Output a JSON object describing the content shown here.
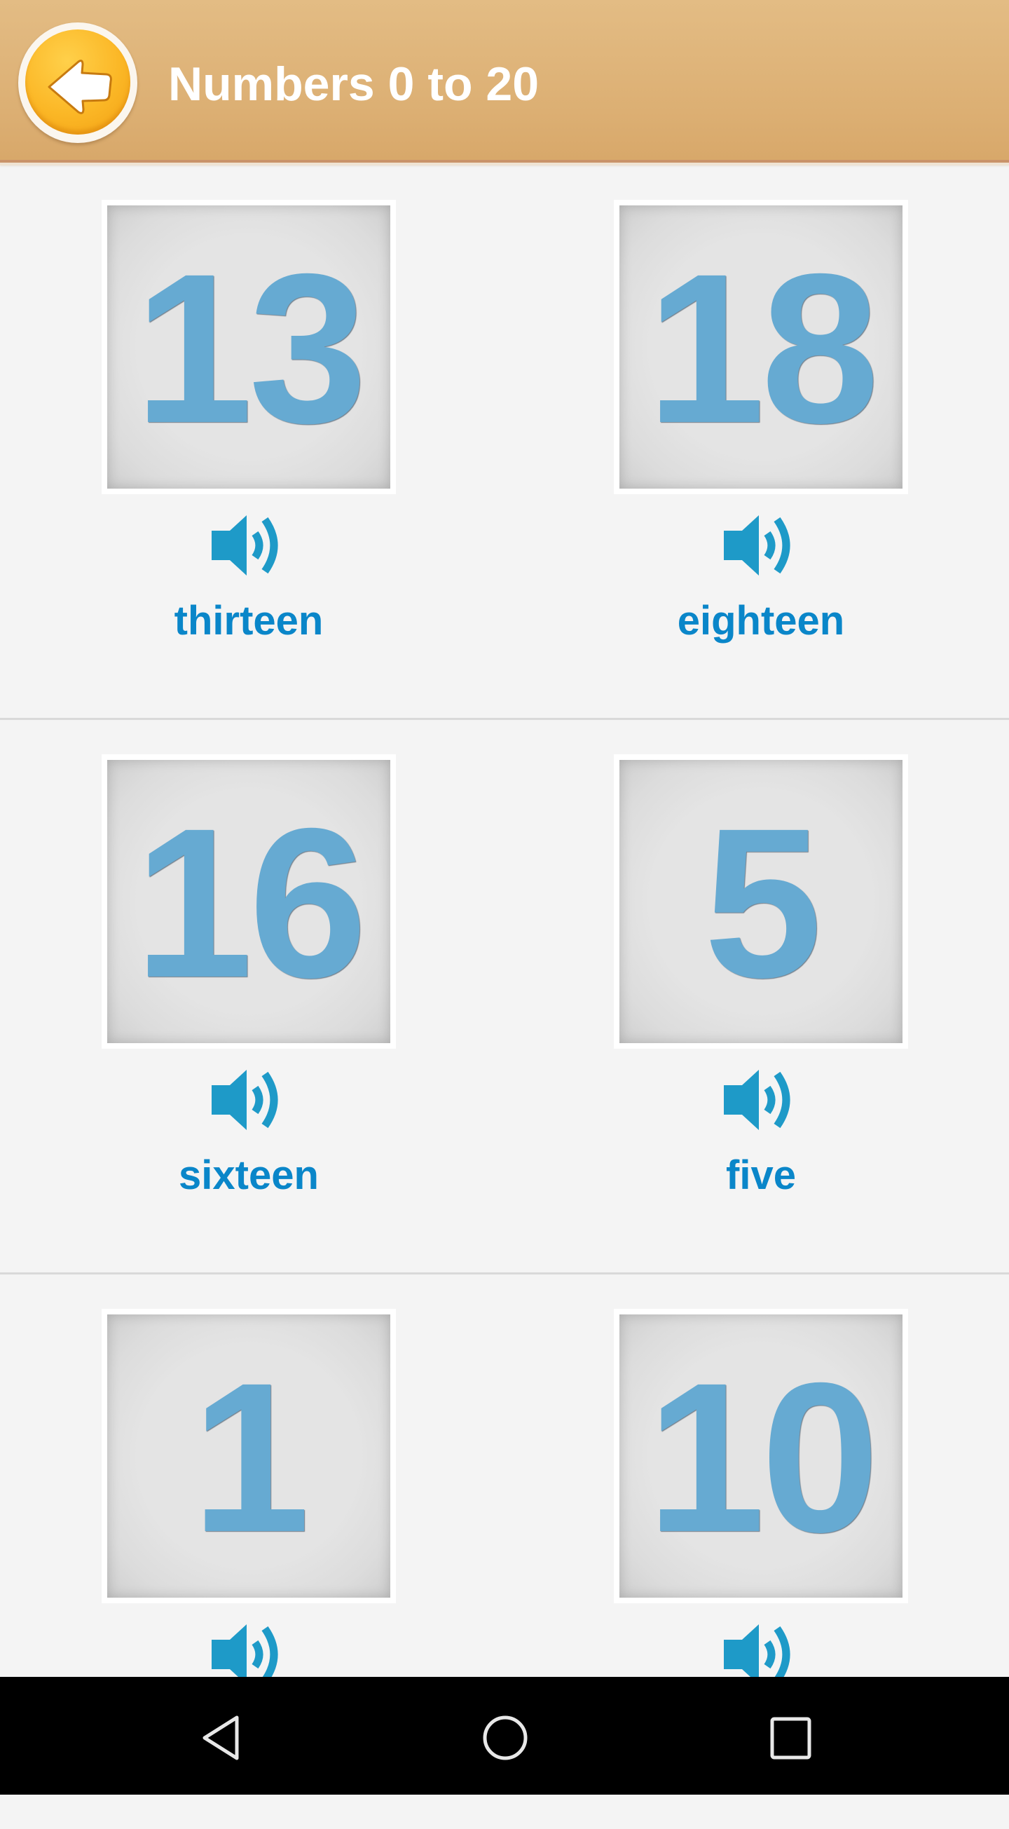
{
  "header": {
    "title": "Numbers 0 to 20",
    "back_icon": "back-arrow-icon",
    "colors": {
      "bar": "#dcaf73",
      "button": "#fbb726",
      "title": "#ffffff"
    }
  },
  "rows": [
    {
      "cards": [
        {
          "number": "13",
          "word": "thirteen",
          "icon": "speaker-icon"
        },
        {
          "number": "18",
          "word": "eighteen",
          "icon": "speaker-icon"
        }
      ]
    },
    {
      "cards": [
        {
          "number": "16",
          "word": "sixteen",
          "icon": "speaker-icon"
        },
        {
          "number": "5",
          "word": "five",
          "icon": "speaker-icon"
        }
      ]
    },
    {
      "cards": [
        {
          "number": "1",
          "word": "",
          "icon": "speaker-icon"
        },
        {
          "number": "10",
          "word": "",
          "icon": "speaker-icon"
        }
      ]
    }
  ],
  "colors": {
    "number": "#66aad2",
    "word": "#0a86c9",
    "speaker": "#1e9ac8",
    "background": "#f4f4f4",
    "divider": "#d9d9d9"
  },
  "navbar": {
    "buttons": [
      {
        "name": "back",
        "icon": "triangle-back-icon"
      },
      {
        "name": "home",
        "icon": "circle-home-icon"
      },
      {
        "name": "recents",
        "icon": "square-recents-icon"
      }
    ]
  }
}
